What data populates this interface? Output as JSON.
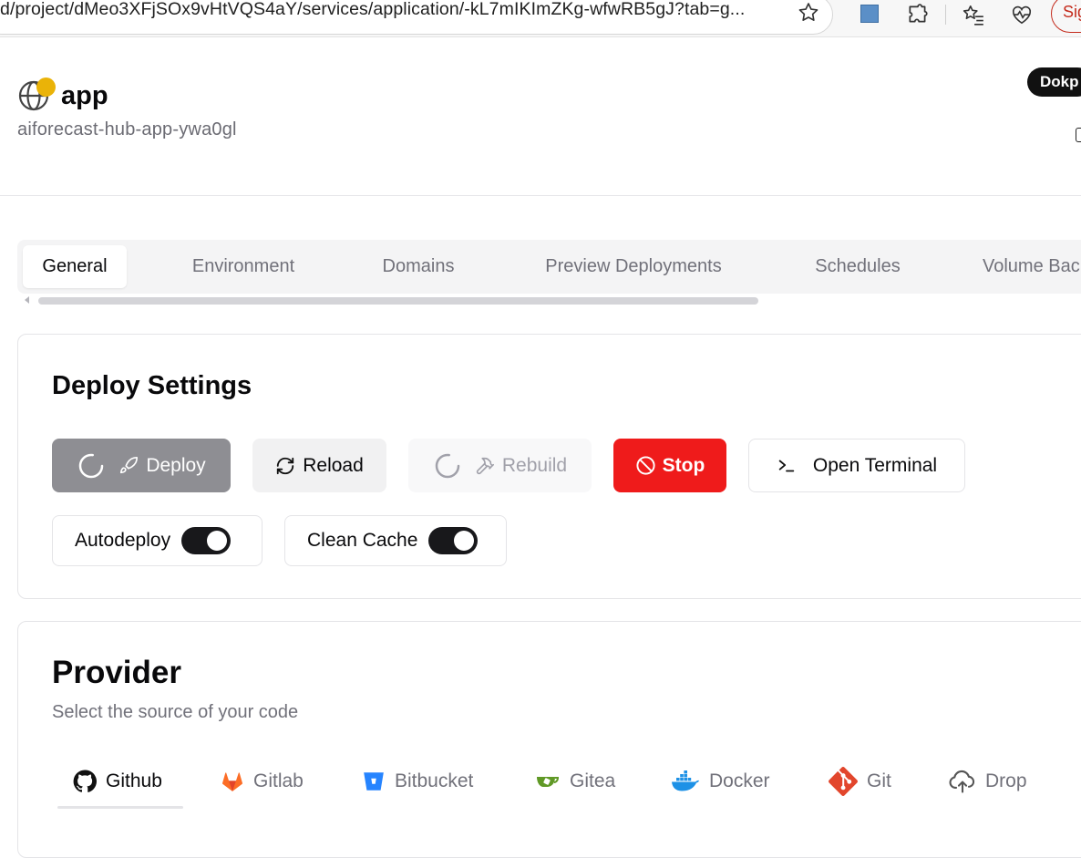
{
  "browser": {
    "url": "d/project/dMeo3XFjSOx9vHtVQS4aY/services/application/-kL7mIKImZKg-wfwRB5gJ?tab=g...",
    "sign_in_label": "Sig"
  },
  "header": {
    "app_name": "app",
    "app_slug": "aiforecast-hub-app-ywa0gl",
    "badge_label": "Dokp",
    "status_color": "#eab308"
  },
  "tabs": [
    {
      "label": "General",
      "active": true
    },
    {
      "label": "Environment"
    },
    {
      "label": "Domains"
    },
    {
      "label": "Preview Deployments"
    },
    {
      "label": "Schedules"
    },
    {
      "label": "Volume Bac"
    }
  ],
  "deploy_settings": {
    "title": "Deploy Settings",
    "deploy_label": "Deploy",
    "reload_label": "Reload",
    "rebuild_label": "Rebuild",
    "stop_label": "Stop",
    "terminal_label": "Open Terminal",
    "autodeploy_label": "Autodeploy",
    "autodeploy_on": true,
    "clean_cache_label": "Clean Cache",
    "clean_cache_on": true
  },
  "provider": {
    "title": "Provider",
    "subtitle": "Select the source of your code",
    "tabs": [
      {
        "label": "Github",
        "icon": "github-icon",
        "active": true
      },
      {
        "label": "Gitlab",
        "icon": "gitlab-icon"
      },
      {
        "label": "Bitbucket",
        "icon": "bitbucket-icon"
      },
      {
        "label": "Gitea",
        "icon": "gitea-icon"
      },
      {
        "label": "Docker",
        "icon": "docker-icon"
      },
      {
        "label": "Git",
        "icon": "git-icon"
      },
      {
        "label": "Drop",
        "icon": "cloud-upload-icon"
      }
    ]
  },
  "colors": {
    "stop": "#ef1b1b",
    "deploy_disabled": "#8e8e93",
    "gitlab": "#fc6d26",
    "bitbucket": "#2684ff",
    "gitea": "#609926",
    "docker": "#1d91e6",
    "git": "#e2462c"
  }
}
